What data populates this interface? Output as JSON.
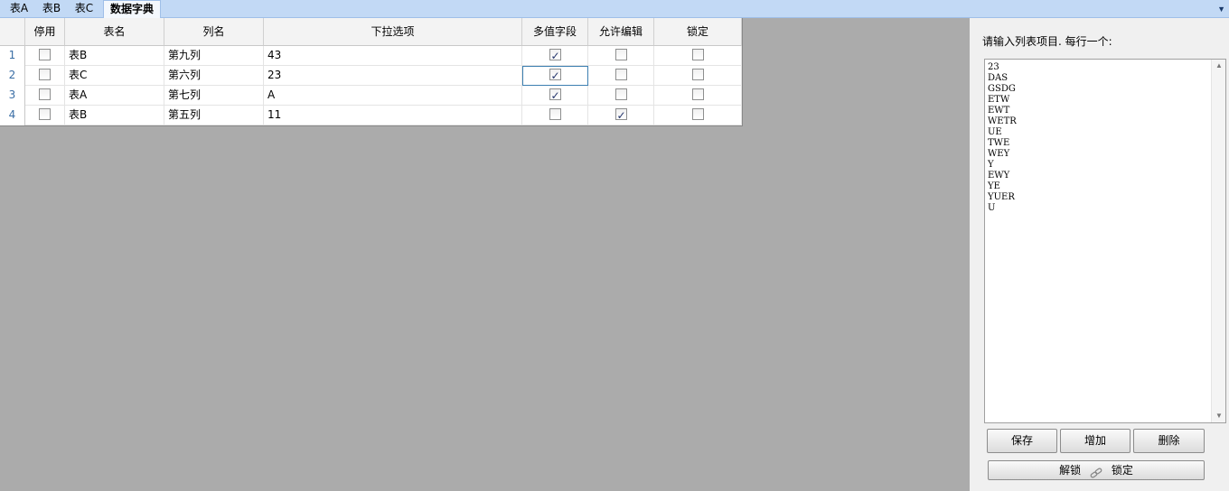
{
  "tabs": [
    {
      "label": "表A"
    },
    {
      "label": "表B"
    },
    {
      "label": "表C"
    },
    {
      "label": "数据字典",
      "active": true
    }
  ],
  "tab_menu_icon": "dropdown-arrow-icon",
  "grid": {
    "headers": [
      "停用",
      "表名",
      "列名",
      "下拉选项",
      "多值字段",
      "允许编辑",
      "锁定"
    ],
    "rows": [
      {
        "num": "1",
        "disabled": false,
        "table": "表B",
        "column": "第九列",
        "options": "43",
        "multi": true,
        "editable": false,
        "locked": false
      },
      {
        "num": "2",
        "disabled": false,
        "table": "表C",
        "column": "第六列",
        "options": "23",
        "multi": true,
        "editable": false,
        "locked": false
      },
      {
        "num": "3",
        "disabled": false,
        "table": "表A",
        "column": "第七列",
        "options": "A",
        "multi": true,
        "editable": false,
        "locked": false
      },
      {
        "num": "4",
        "disabled": false,
        "table": "表B",
        "column": "第五列",
        "options": "11",
        "multi": false,
        "editable": true,
        "locked": false
      }
    ]
  },
  "side": {
    "label": "请输入列表项目. 每行一个:",
    "items": [
      "23",
      "DAS",
      "GSDG",
      "ETW",
      "EWT",
      "WETR",
      "UE",
      "TWE",
      "WEY",
      "Y",
      "EWY",
      "YE",
      "YUER",
      "U"
    ],
    "buttons": {
      "save": "保存",
      "add": "增加",
      "delete": "删除",
      "unlock": "解锁",
      "lock": "锁定"
    }
  },
  "colors": {
    "tab_bar": "#c2d9f5",
    "background": "#ababab",
    "panel": "#f0f0f0",
    "row_number": "#3a6ea5"
  }
}
